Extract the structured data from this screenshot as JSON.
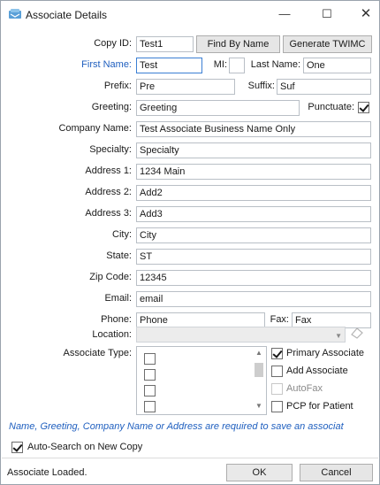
{
  "window": {
    "title": "Associate Details",
    "minimize_glyph": "—",
    "maximize_glyph": "☐",
    "close_glyph": "✕"
  },
  "copy_id": {
    "label": "Copy ID:",
    "value": "Test1",
    "find_button": "Find By Name",
    "generate_button": "Generate TWIMC"
  },
  "name": {
    "first_label": "First Name:",
    "first_value": "Test",
    "mi_label": "MI:",
    "mi_value": "",
    "last_label": "Last Name:",
    "last_value": "One"
  },
  "prefix": {
    "label": "Prefix:",
    "value": "Pre",
    "suffix_label": "Suffix:",
    "suffix_value": "Suf"
  },
  "greeting": {
    "label": "Greeting:",
    "value": "Greeting",
    "punctuate_label": "Punctuate:",
    "punctuate_checked": true
  },
  "company": {
    "label": "Company Name:",
    "value": "Test Associate Business Name Only"
  },
  "specialty": {
    "label": "Specialty:",
    "value": "Specialty"
  },
  "address1": {
    "label": "Address 1:",
    "value": "1234 Main"
  },
  "address2": {
    "label": "Address 2:",
    "value": "Add2"
  },
  "address3": {
    "label": "Address 3:",
    "value": "Add3"
  },
  "city": {
    "label": "City:",
    "value": "City"
  },
  "state": {
    "label": "State:",
    "value": "ST"
  },
  "zip": {
    "label": "Zip Code:",
    "value": "12345"
  },
  "email": {
    "label": "Email:",
    "value": "email"
  },
  "phone": {
    "label": "Phone:",
    "value": "Phone",
    "fax_label": "Fax:",
    "fax_value": "Fax"
  },
  "location": {
    "label": "Location:",
    "value": ""
  },
  "associate_type": {
    "label": "Associate Type:",
    "list_items": [
      false,
      false,
      false,
      false
    ],
    "options": [
      {
        "label": "Primary Associate",
        "checked": true
      },
      {
        "label": "Add Associate",
        "checked": false
      },
      {
        "label": "AutoFax",
        "checked": false,
        "disabled": true
      },
      {
        "label": "PCP for Patient",
        "checked": false
      }
    ]
  },
  "notice": "Name, Greeting, Company Name or Address are required to save an associat",
  "auto_search": {
    "label": "Auto-Search on New Copy",
    "checked": true
  },
  "status": "Associate Loaded.",
  "buttons": {
    "ok": "OK",
    "cancel": "Cancel"
  },
  "colors": {
    "accent_blue": "#1f5fbf",
    "focus_border": "#3b7fd4"
  }
}
